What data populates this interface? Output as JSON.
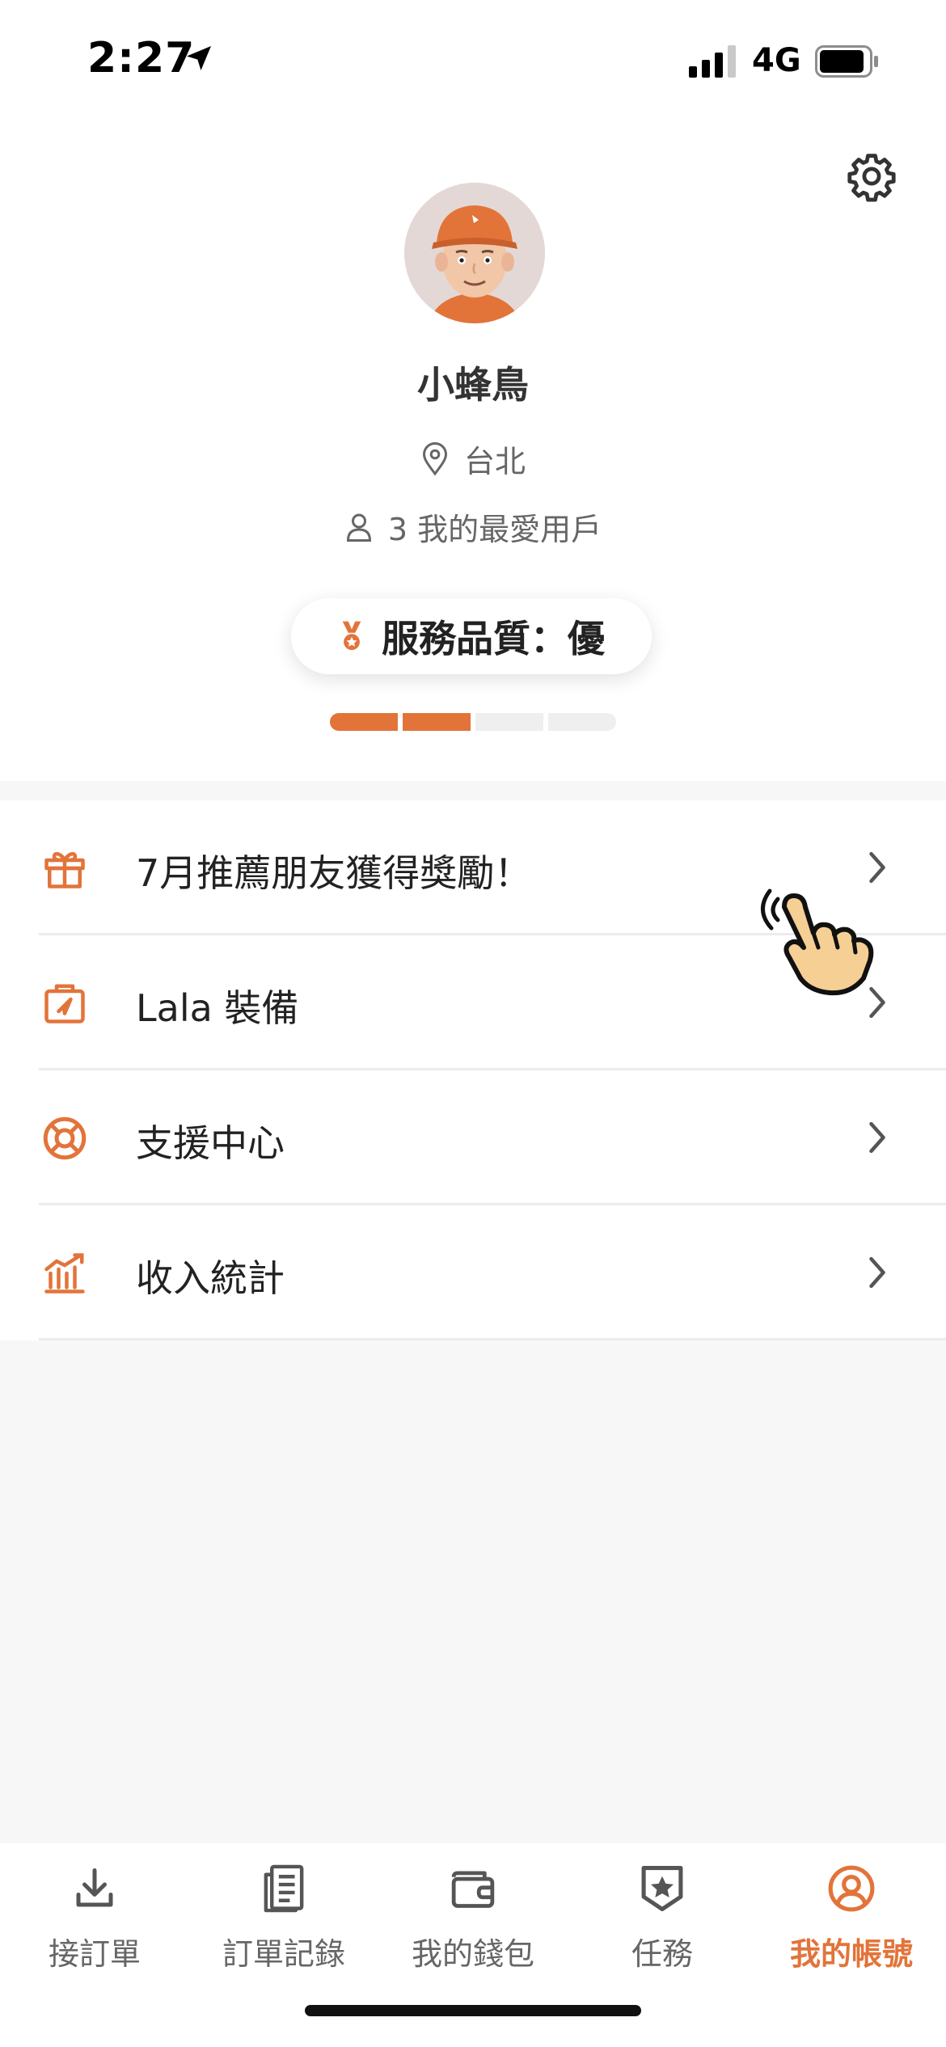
{
  "status_bar": {
    "time": "2:27",
    "network": "4G"
  },
  "profile": {
    "name": "小蜂鳥",
    "location": "台北",
    "favorites": "3 我的最愛用戶",
    "quality_label": "服務品質：優",
    "quality_level": 2,
    "quality_segments": 4
  },
  "menu": {
    "items": [
      {
        "label": "7月推薦朋友獲得獎勵！",
        "icon": "gift-icon"
      },
      {
        "label": "Lala 裝備",
        "icon": "bag-icon"
      },
      {
        "label": "支援中心",
        "icon": "lifebuoy-icon"
      },
      {
        "label": "收入統計",
        "icon": "chart-icon"
      }
    ]
  },
  "tabbar": {
    "tabs": [
      {
        "label": "接訂單",
        "icon": "download-icon"
      },
      {
        "label": "訂單記錄",
        "icon": "document-icon"
      },
      {
        "label": "我的錢包",
        "icon": "wallet-icon"
      },
      {
        "label": "任務",
        "icon": "star-badge-icon"
      },
      {
        "label": "我的帳號",
        "icon": "user-circle-icon"
      }
    ],
    "active_index": 4
  },
  "colors": {
    "accent": "#e2743a",
    "text": "#222222",
    "muted": "#666666",
    "background": "#f7f7f7"
  }
}
